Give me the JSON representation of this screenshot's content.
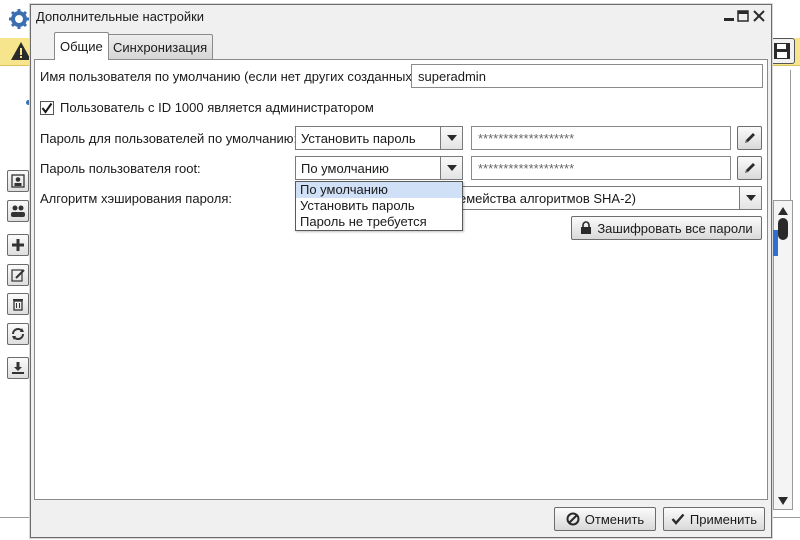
{
  "dialog": {
    "title": "Дополнительные настройки",
    "tabs": [
      {
        "label": "Общие",
        "active": true
      },
      {
        "label": "Синхронизация",
        "active": false
      }
    ]
  },
  "general": {
    "default_user_label": "Имя пользователя по умолчанию (если нет других созданных):",
    "default_user_value": "superadmin",
    "admin_checkbox_label": "Пользователь с ID 1000 является администратором",
    "admin_checkbox_checked": true,
    "default_password_label": "Пароль для пользователей по умолчанию:",
    "default_password_mode": "Установить пароль",
    "default_password_value": "*******************",
    "root_password_label": "Пароль пользователя root:",
    "root_password_mode": "По умолчанию",
    "root_password_value": "*******************",
    "hash_algorithm_label": "Алгоритм хэширования пароля:",
    "hash_algorithm_value": "емейства алгоритмов SHA-2)",
    "encrypt_all_button": "Зашифровать все пароли"
  },
  "root_password_dropdown": {
    "options": [
      "По умолчанию",
      "Установить пароль",
      "Пароль не требуется"
    ],
    "selected_index": 0
  },
  "footer": {
    "cancel_button": "Отменить",
    "apply_button": "Применить"
  },
  "colors": {
    "warning_bar": "#f7e58e",
    "selection": "#cfe0f7",
    "accent": "#3b6fb0"
  },
  "icons": {
    "app": "gear-icon",
    "warning": "warning-icon",
    "save": "floppy-disk-icon",
    "edit": "pencil-icon",
    "lock": "lock-icon",
    "cancel": "cancel-circle-icon",
    "apply": "checkmark-icon"
  }
}
